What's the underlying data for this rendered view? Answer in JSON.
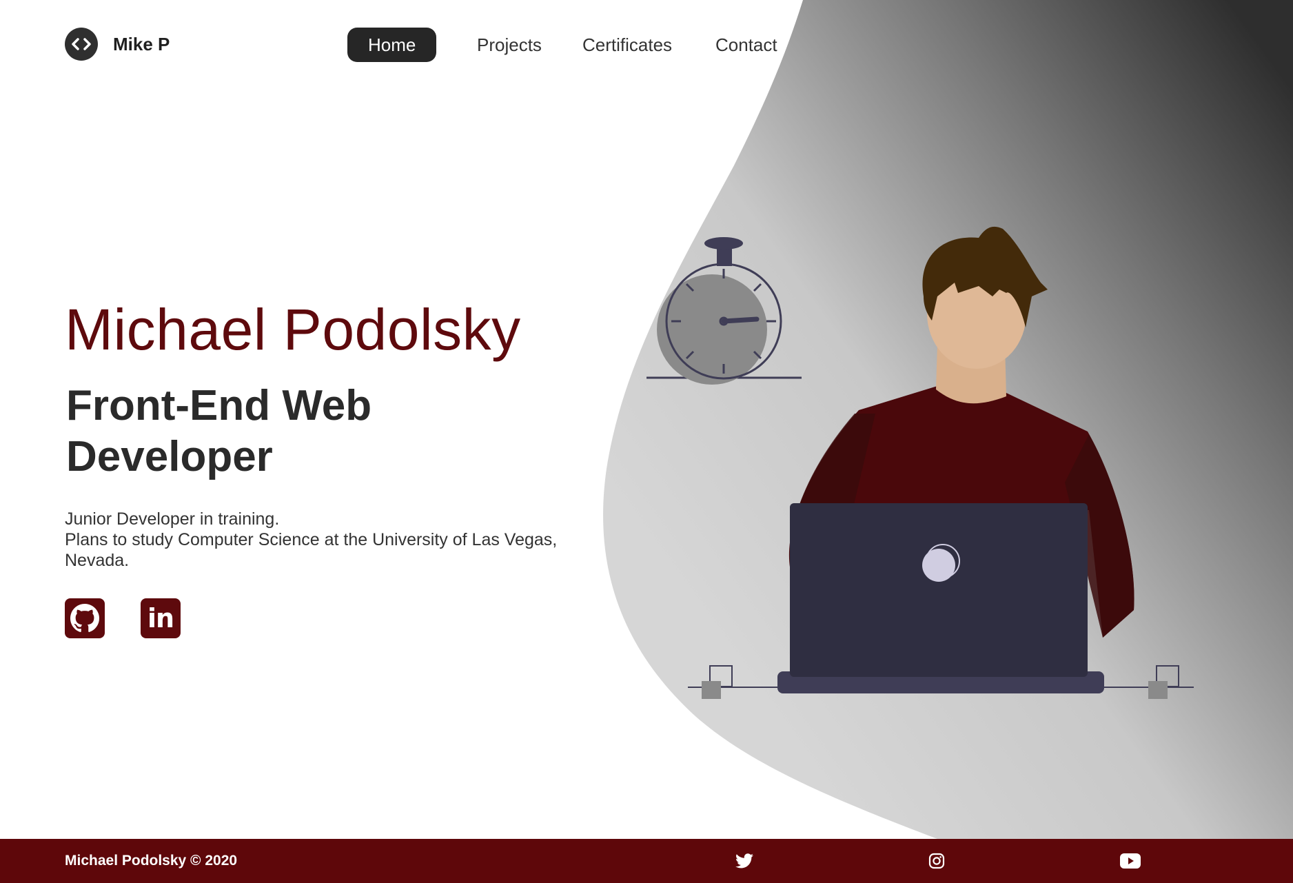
{
  "brand": {
    "logo_icon": "code-brackets-icon",
    "name": "Mike P"
  },
  "nav": {
    "items": [
      {
        "label": "Home",
        "active": true
      },
      {
        "label": "Projects",
        "active": false
      },
      {
        "label": "Certificates",
        "active": false
      },
      {
        "label": "Contact",
        "active": false
      }
    ]
  },
  "hero": {
    "name": "Michael Podolsky",
    "role_line1": "Front-End Web",
    "role_line2": "Developer",
    "description": [
      "Junior Developer in training.",
      "Plans to study Computer Science at the University of Las Vegas,",
      "Nevada."
    ]
  },
  "socials": [
    {
      "icon": "github-icon"
    },
    {
      "icon": "linkedin-icon",
      "text": "in"
    }
  ],
  "footer": {
    "copyright": "Michael Podolsky © 2020",
    "icons": [
      "twitter-icon",
      "instagram-icon",
      "youtube-icon"
    ]
  },
  "colors": {
    "accent": "#5e0a0d",
    "footer_bg": "#5e070a",
    "nav_active_bg": "#262626",
    "dark_text": "#2a2a2a"
  }
}
